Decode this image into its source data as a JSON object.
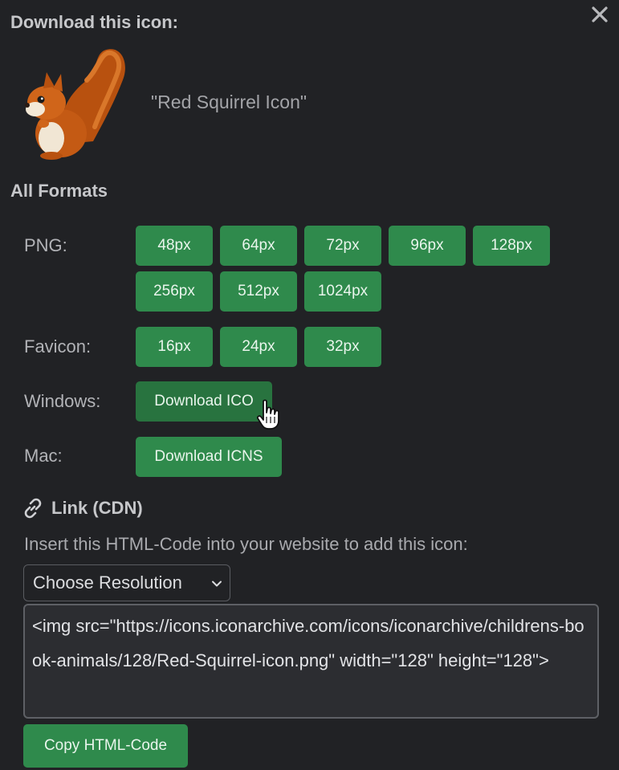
{
  "dialog": {
    "title": "Download this icon:",
    "close_icon": "close-icon"
  },
  "icon": {
    "name": "\"Red Squirrel Icon\"",
    "image": "red-squirrel-illustration"
  },
  "formats": {
    "heading": "All Formats",
    "png": {
      "label": "PNG:",
      "sizes": [
        "48px",
        "64px",
        "72px",
        "96px",
        "128px",
        "256px",
        "512px",
        "1024px"
      ]
    },
    "favicon": {
      "label": "Favicon:",
      "sizes": [
        "16px",
        "24px",
        "32px"
      ]
    },
    "windows": {
      "label": "Windows:",
      "button": "Download ICO"
    },
    "mac": {
      "label": "Mac:",
      "button": "Download ICNS"
    }
  },
  "cdn": {
    "link_icon": "link-icon",
    "heading": "Link (CDN)",
    "instruction": "Insert this HTML-Code into your website to add this icon:",
    "resolution_select": "Choose Resolution",
    "code": "<img src=\"https://icons.iconarchive.com/icons/iconarchive/childrens-book-animals/128/Red-Squirrel-icon.png\" width=\"128\" height=\"128\">",
    "copy_button": "Copy HTML-Code"
  },
  "colors": {
    "background": "#212225",
    "button_green": "#2f8a4c",
    "button_green_hover": "#28733f"
  }
}
